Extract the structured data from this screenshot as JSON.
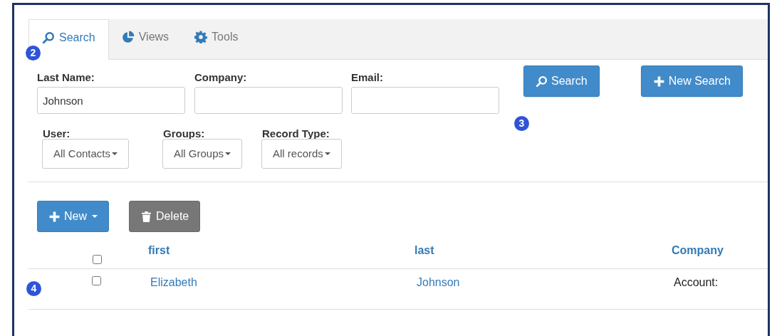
{
  "tabs": [
    {
      "label": "Search",
      "selected": true
    },
    {
      "label": "Views",
      "selected": false
    },
    {
      "label": "Tools",
      "selected": false
    }
  ],
  "markers": [
    "2",
    "3",
    "4"
  ],
  "search_form": {
    "fields": [
      {
        "label": "Last Name:",
        "value": "Johnson"
      },
      {
        "label": "Company:"
      },
      {
        "label": "Email:"
      }
    ],
    "buttons": [
      {
        "label": "Search",
        "kind": "search"
      },
      {
        "label": "New Search",
        "kind": "new"
      }
    ],
    "filters": [
      {
        "label": "User:",
        "value": "All Contacts"
      },
      {
        "label": "Groups:",
        "value": "All Groups"
      },
      {
        "label": "Record Type:",
        "value": "All records"
      }
    ]
  },
  "actions": [
    {
      "label": "New",
      "kind": "new"
    },
    {
      "label": "Delete",
      "kind": "delete"
    }
  ],
  "table": {
    "select_all_checked": false,
    "columns": [
      "first",
      "last",
      "Company"
    ],
    "rows": [
      {
        "checked": false,
        "cells": [
          "Elizabeth",
          "Johnson",
          "Account:"
        ]
      }
    ]
  }
}
